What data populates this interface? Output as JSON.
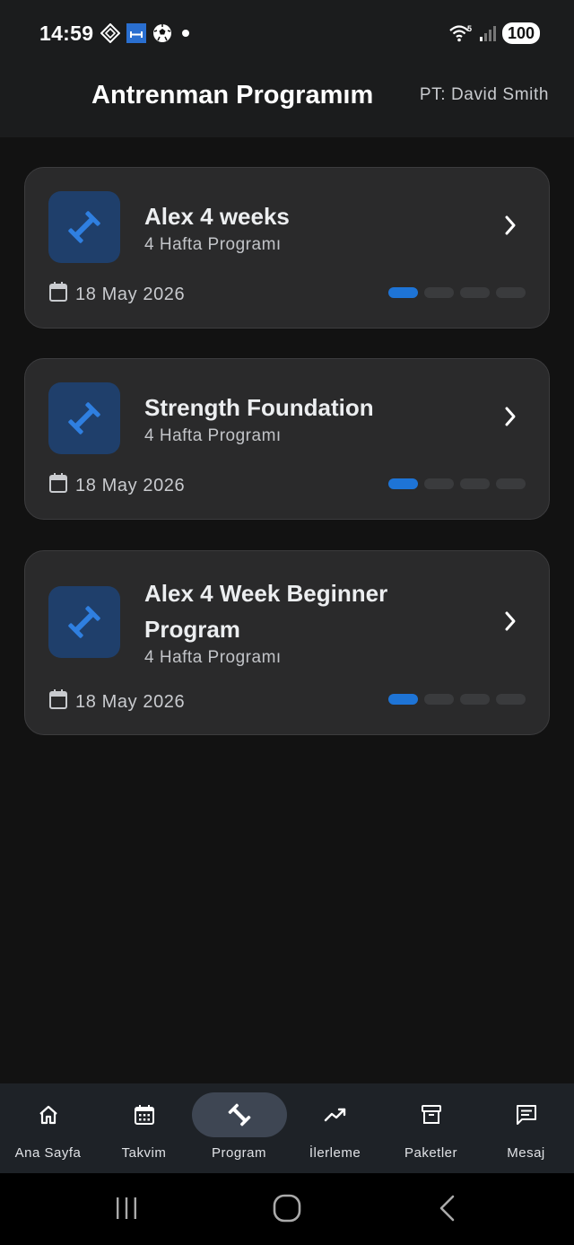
{
  "status_bar": {
    "time": "14:59",
    "battery": "100",
    "icons": [
      "diamond-grid-icon",
      "blue-calendar-icon",
      "soccer-ball-icon",
      "notification-dot-icon",
      "wifi-icon",
      "signal-icon"
    ]
  },
  "header": {
    "title": "Antrenman Programım",
    "trainer": "PT: David Smith"
  },
  "programs": [
    {
      "title": "Alex 4 weeks",
      "subtitle": "4 Hafta Programı",
      "date": "18 May 2026",
      "progress_active": 1,
      "progress_total": 4
    },
    {
      "title": "Strength Foundation",
      "subtitle": "4 Hafta Programı",
      "date": "18 May 2026",
      "progress_active": 1,
      "progress_total": 4
    },
    {
      "title": "Alex 4 Week Beginner Program",
      "subtitle": "4 Hafta Programı",
      "date": "18 May 2026",
      "progress_active": 1,
      "progress_total": 4
    }
  ],
  "nav": {
    "items": [
      {
        "label": "Ana Sayfa",
        "icon": "home-icon"
      },
      {
        "label": "Takvim",
        "icon": "calendar-icon"
      },
      {
        "label": "Program",
        "icon": "dumbbell-icon",
        "active": true
      },
      {
        "label": "İlerleme",
        "icon": "trending-up-icon"
      },
      {
        "label": "Paketler",
        "icon": "archive-box-icon"
      },
      {
        "label": "Mesaj",
        "icon": "message-icon"
      }
    ]
  },
  "colors": {
    "accent": "#1e74d6",
    "background": "#121212",
    "card": "#2a2a2b",
    "thumb": "#1f3f6b"
  }
}
